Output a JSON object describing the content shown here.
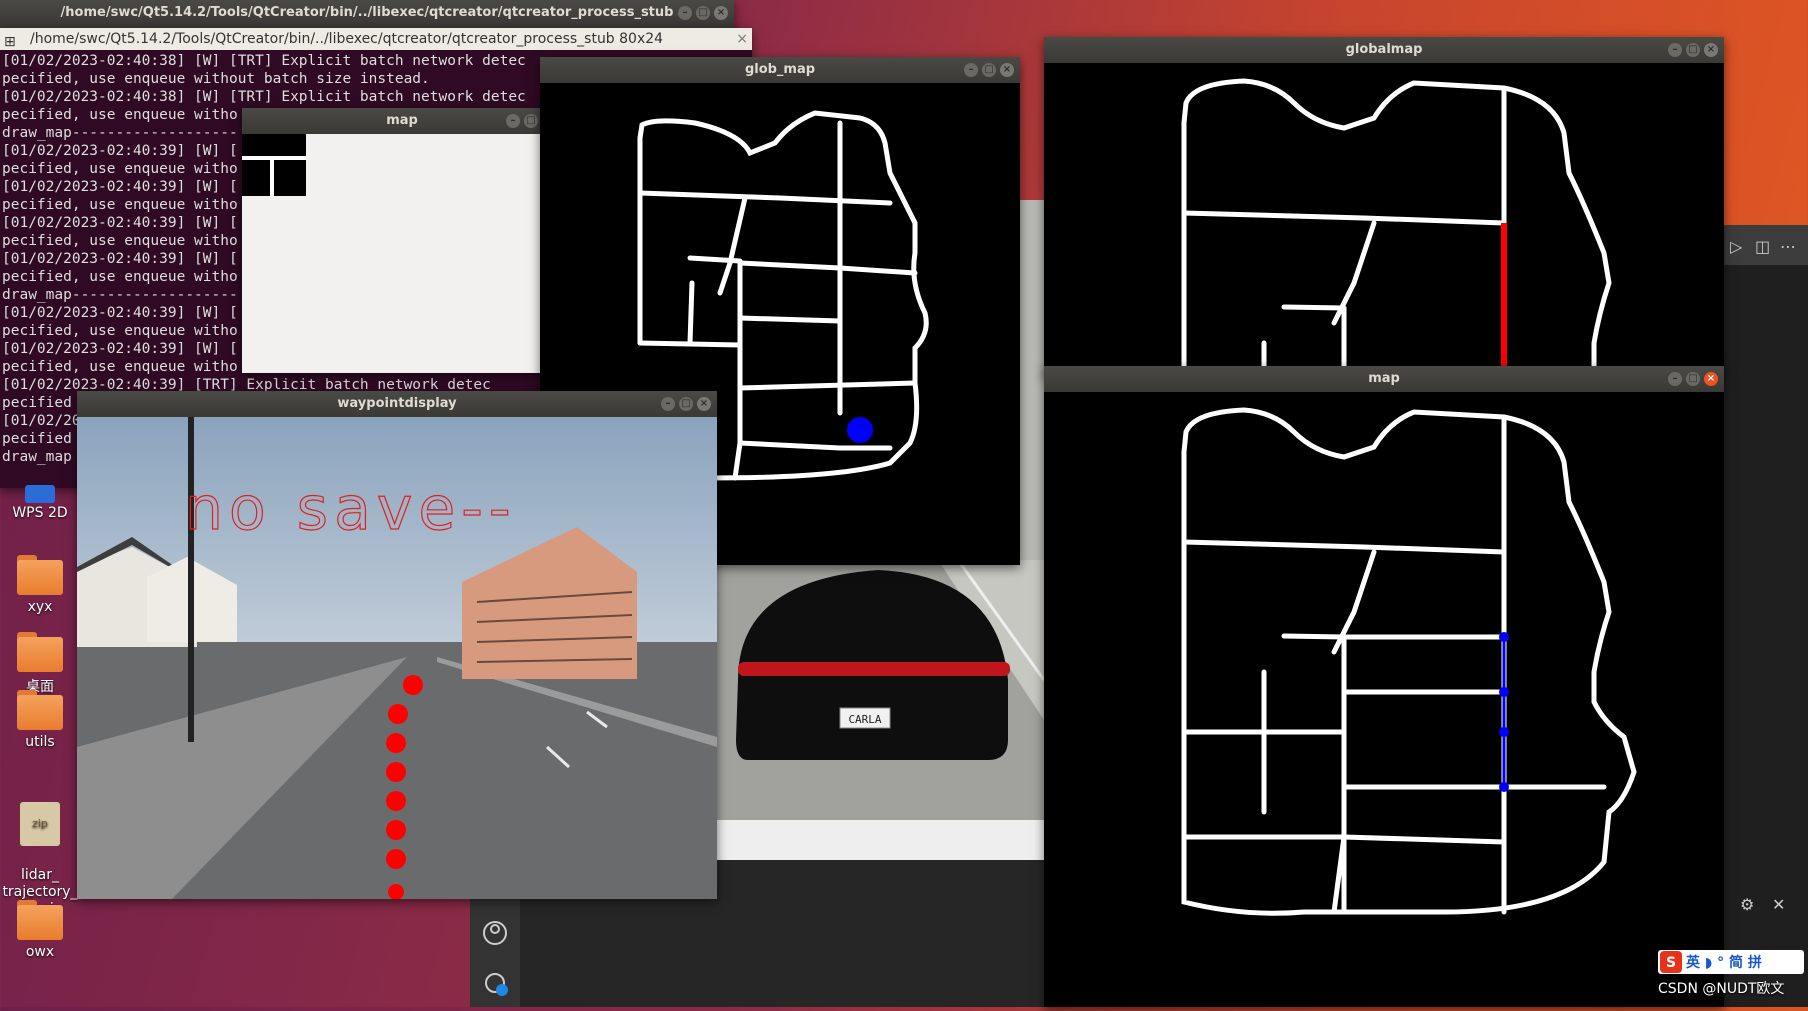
{
  "terminal": {
    "back_title": "/home/swc/Qt5.14.2/Tools/QtCreator/bin/../libexec/qtcreator/qtcreator_process_stub",
    "title": "/home/swc/Qt5.14.2/Tools/QtCreator/bin/../libexec/qtcreator/qtcreator_process_stub 80x24",
    "lines": [
      "[01/02/2023-02:40:38] [W] [TRT] Explicit batch network detec",
      "pecified, use enqueue without batch size instead.",
      "[01/02/2023-02:40:38] [W] [TRT] Explicit batch network detec",
      "pecified, use enqueue witho",
      "draw_map-------------------",
      "[01/02/2023-02:40:39] [W] [",
      "pecified, use enqueue witho",
      "[01/02/2023-02:40:39] [W] [",
      "pecified, use enqueue witho",
      "[01/02/2023-02:40:39] [W] [",
      "pecified, use enqueue witho",
      "[01/02/2023-02:40:39] [W] [",
      "pecified, use enqueue witho",
      "draw_map-------------------",
      "[01/02/2023-02:40:39] [W] [",
      "pecified, use enqueue witho",
      "[01/02/2023-02:40:39] [W] [",
      "pecified, use enqueue witho",
      "[01/02/2023-02:40:39] [TRT] Explicit batch network detec",
      "pecified",
      "[01/02/20",
      "pecified",
      "draw_map"
    ]
  },
  "windows": {
    "map_small": "map",
    "glob_map": "glob_map",
    "globalmap": "globalmap",
    "map_large": "map",
    "waypointdisplay": "waypointdisplay"
  },
  "waypoint_overlay_text": "no save--",
  "carla_plate": "CARLA",
  "desktop": {
    "items": [
      {
        "label": "WPS 2D"
      },
      {
        "label": "xyx"
      },
      {
        "label": "桌面"
      },
      {
        "label": "utils"
      },
      {
        "label": "lidar_\ntrajectory_\ncar.zip"
      },
      {
        "label": "owx"
      }
    ]
  },
  "ime": {
    "logo": "S",
    "text": "英 ◗ ° 简 拼"
  },
  "watermark": "CSDN @NUDT欧文",
  "colors": {
    "accent_close": "#e9541f",
    "waypoint": "#ff0000",
    "path_blue": "#0000ff",
    "route_red": "#ff0000"
  }
}
